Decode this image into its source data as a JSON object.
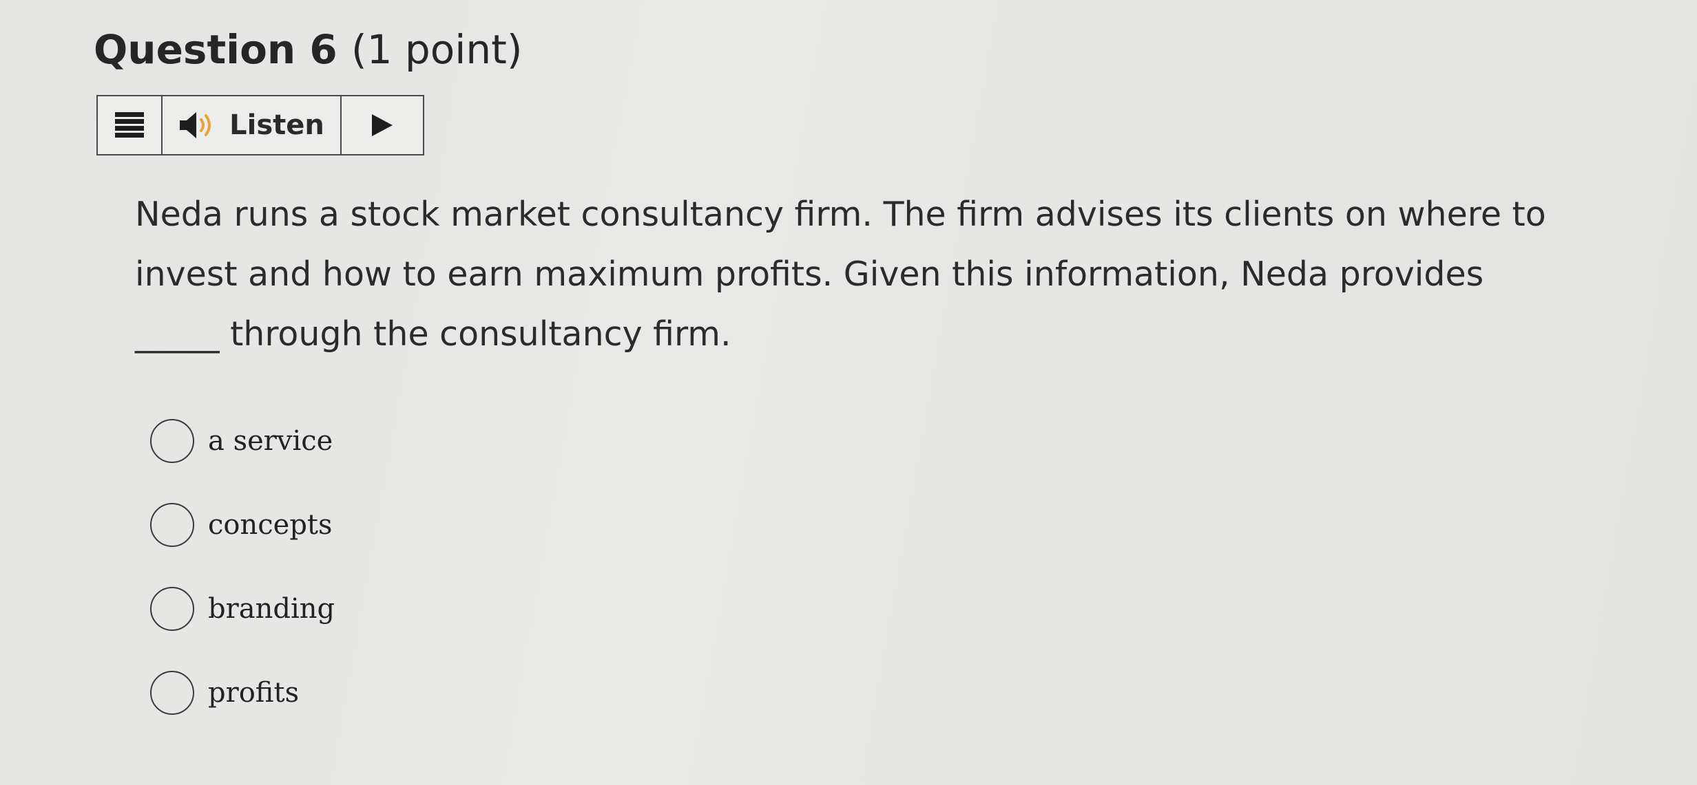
{
  "question": {
    "title_number": "Question 6",
    "title_points": "(1 point)",
    "text_line1": "Neda runs a stock market consultancy firm. The firm advises its clients on where to",
    "text_line2": "invest and how to earn maximum profits. Given this information, Neda provides",
    "text_line3": "_____ through the consultancy firm."
  },
  "toolbar": {
    "menu_icon": "hamburger-menu-icon",
    "speaker_icon": "speaker-icon",
    "listen_label": "Listen",
    "play_icon": "play-icon"
  },
  "options": [
    {
      "label": "a service",
      "selected": false
    },
    {
      "label": "concepts",
      "selected": false
    },
    {
      "label": "branding",
      "selected": false
    },
    {
      "label": "profits",
      "selected": false
    }
  ],
  "colors": {
    "background": "#e6e6e4",
    "text": "#2b2b2b",
    "border": "#4a4a4a"
  }
}
